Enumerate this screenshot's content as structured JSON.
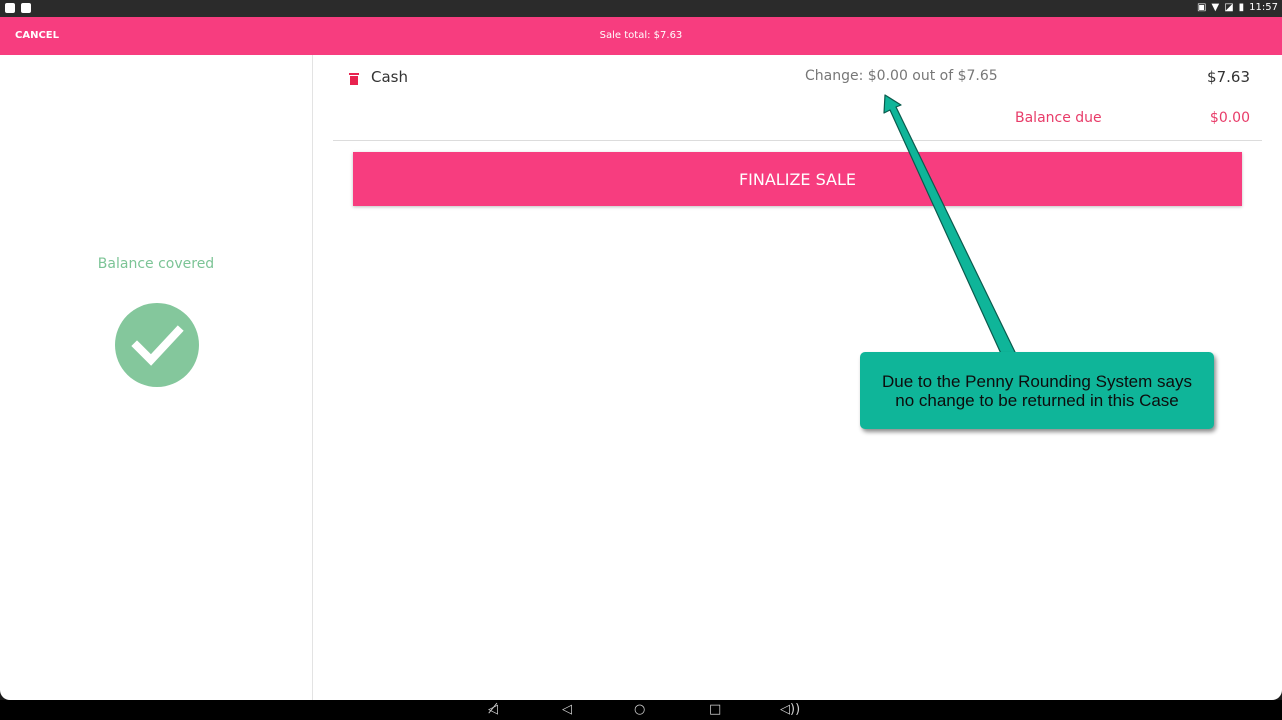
{
  "status_bar": {
    "time": "11:57"
  },
  "header": {
    "cancel_label": "CANCEL",
    "sale_total": "Sale total: $7.63"
  },
  "left": {
    "balance_covered": "Balance covered"
  },
  "payment": {
    "method": "Cash",
    "change_text": "Change: $0.00 out of $7.65",
    "amount": "$7.63",
    "balance_due_label": "Balance due",
    "balance_due_value": "$0.00"
  },
  "finalize_label": "FINALIZE SALE",
  "annotation": {
    "line1": "Due to the Penny Rounding System says",
    "line2": "no change to be returned in this Case"
  },
  "colors": {
    "accent": "#f73d7f",
    "success": "#84c79c",
    "balance_due": "#e83c69",
    "callout": "#0fb599"
  }
}
